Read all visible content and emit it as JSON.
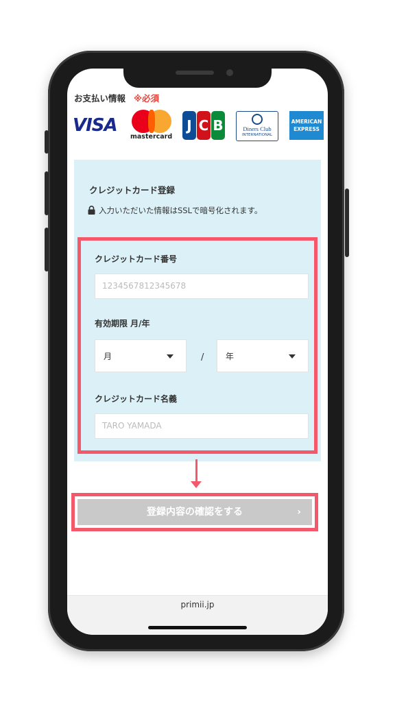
{
  "payment": {
    "section_title": "お支払い情報",
    "required": "※必須",
    "card_logos": {
      "visa": "VISA",
      "mastercard": "mastercard",
      "jcb": [
        "J",
        "C",
        "B"
      ],
      "diners_line1": "Diners Club",
      "diners_line2": "INTERNATIONAL",
      "amex_line1": "AMERICAN",
      "amex_line2": "EXPRESS"
    }
  },
  "form": {
    "title": "クレジットカード登録",
    "ssl_note": "入力いただいた情報はSSLで暗号化されます。",
    "card_number_label": "クレジットカード番号",
    "card_number_placeholder": "1234567812345678",
    "expiry_label": "有効期限 月/年",
    "month_value": "月",
    "separator": "/",
    "year_value": "年",
    "name_label": "クレジットカード名義",
    "name_placeholder": "TARO YAMADA"
  },
  "confirm_button": {
    "label": "登録内容の確認をする",
    "chevron": "›"
  },
  "browser": {
    "url": "primii.jp"
  },
  "colors": {
    "highlight": "#f3596a",
    "panel": "#dcf1f7",
    "required": "#e8453c",
    "button": "#c9c9c9"
  }
}
